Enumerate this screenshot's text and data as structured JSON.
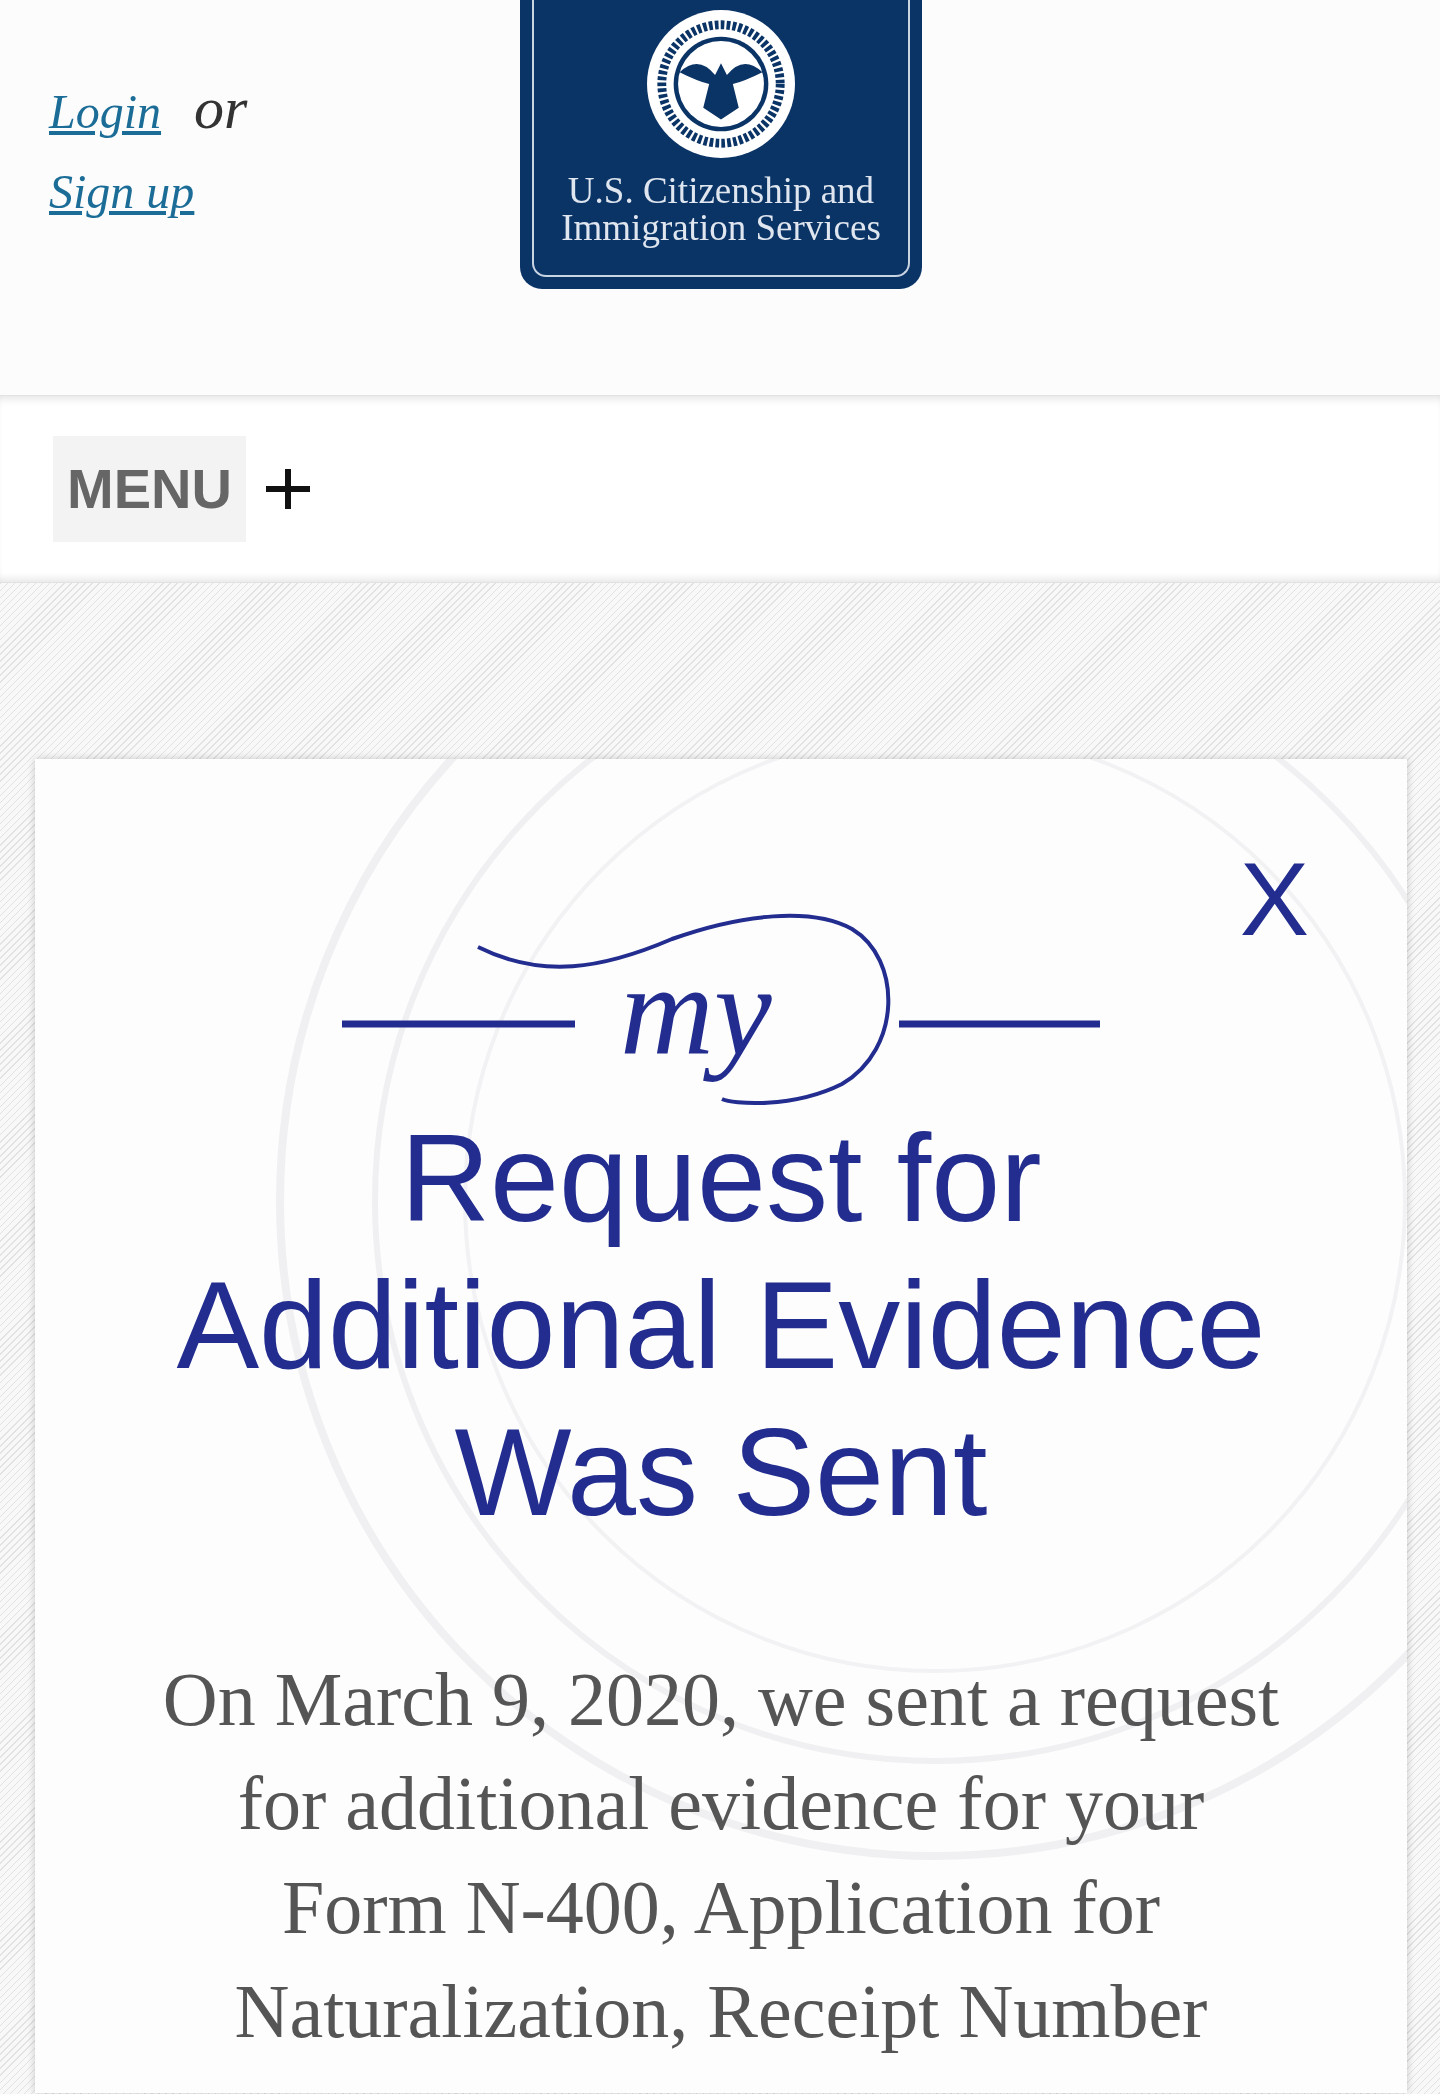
{
  "header": {
    "login_link": "Login",
    "separator": "or",
    "signup_link": "Sign up",
    "logo_text": "U.S. Citizenship and Immigration Services"
  },
  "nav": {
    "menu_label": "MENU"
  },
  "modal": {
    "close_label": "X",
    "brand_mark": "my",
    "title": "Request for Additional Evidence Was Sent",
    "message": "On March 9, 2020, we sent a request for additional evidence for your Form N-400, Application for Naturalization, Receipt Number"
  }
}
